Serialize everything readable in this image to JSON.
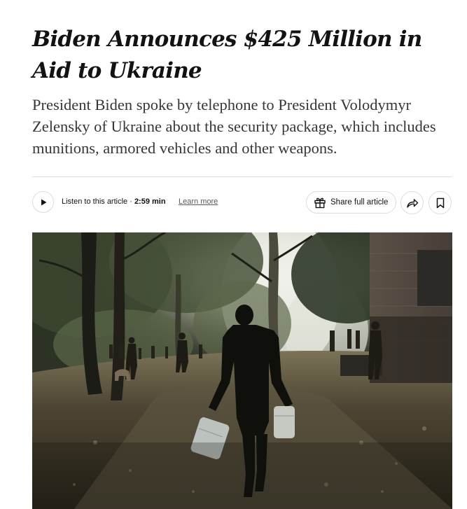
{
  "article": {
    "headline": "Biden Announces $425 Million in Aid to Ukraine",
    "summary": "President Biden spoke by telephone to President Volodymyr Zelensky of Ukraine about the security package, which includes munitions, armored vehicles and other weapons."
  },
  "toolbar": {
    "listen_label": "Listen to this article",
    "separator": " · ",
    "duration": "2:59 min",
    "learn_more": "Learn more",
    "share_label": "Share full article",
    "icons": {
      "play": "play-icon",
      "gift": "gift-icon",
      "share": "share-arrow-icon",
      "save": "bookmark-icon"
    }
  },
  "photo": {
    "description_icon": "lead-photo",
    "colors": {
      "foliage": "#3c4530",
      "light": "#eef0ea",
      "ground": "#4a3f2e",
      "shadow": "#141511"
    }
  }
}
